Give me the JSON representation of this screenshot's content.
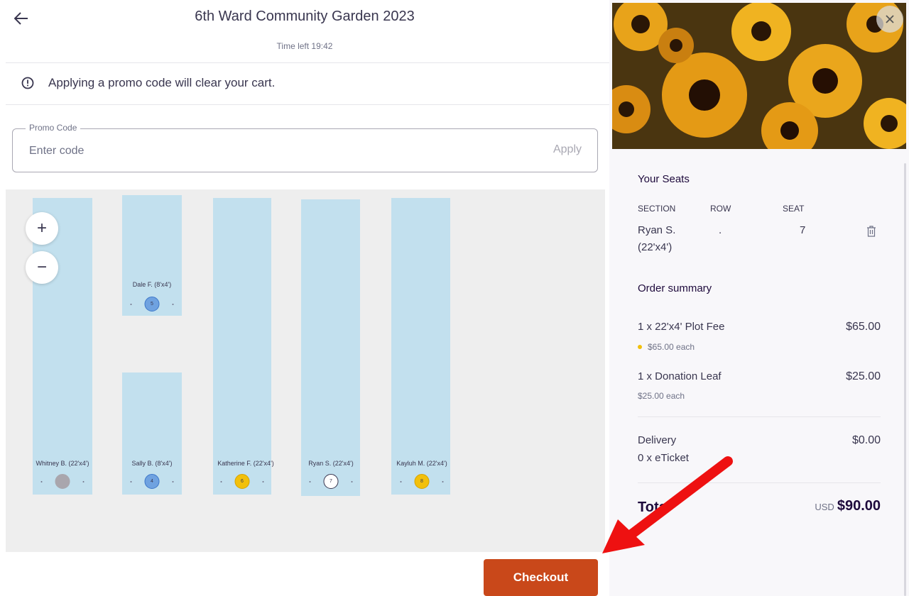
{
  "header": {
    "title": "6th Ward Community Garden 2023",
    "timer": "Time left 19:42"
  },
  "notice": {
    "text": "Applying a promo code will clear your cart."
  },
  "promo": {
    "label": "Promo Code",
    "placeholder": "Enter code",
    "apply_label": "Apply"
  },
  "map": {
    "zoom_in": "+",
    "zoom_out": "−",
    "plots": [
      {
        "label": "Dale F. (8'x4')",
        "seat": "5",
        "status": "selected-blue"
      },
      {
        "label": "Whitney B. (22'x4')",
        "seat": "",
        "status": "unavailable"
      },
      {
        "label": "Sally B. (8'x4')",
        "seat": "4",
        "status": "selected-blue"
      },
      {
        "label": "Katherine F. (22'x4')",
        "seat": "6",
        "status": "available"
      },
      {
        "label": "Ryan S. (22'x4')",
        "seat": "7",
        "status": "in-cart"
      },
      {
        "label": "Kayluh M. (22'x4')",
        "seat": "8",
        "status": "available"
      }
    ]
  },
  "checkout": {
    "label": "Checkout"
  },
  "cart": {
    "your_seats_title": "Your Seats",
    "headers": {
      "section": "SECTION",
      "row": "ROW",
      "seat": "SEAT"
    },
    "seat_item": {
      "section_line1": "Ryan S.",
      "section_line2": "(22'x4')",
      "row": ".",
      "seat": "7"
    },
    "order_summary_title": "Order summary",
    "items": [
      {
        "name": "1 x 22'x4' Plot Fee",
        "each": "$65.00 each",
        "price": "$65.00"
      },
      {
        "name": "1 x Donation Leaf",
        "each": "$25.00 each",
        "price": "$25.00"
      }
    ],
    "delivery": {
      "name": "Delivery",
      "detail": "0 x eTicket",
      "price": "$0.00"
    },
    "total": {
      "label": "Total",
      "currency": "USD",
      "amount": "$90.00"
    }
  },
  "colors": {
    "accent": "#c9481a",
    "plot": "#c2e0ee",
    "seat_yellow": "#f2c00b",
    "seat_blue": "#6fa2e0",
    "arrow": "#ee1111"
  },
  "icons": {
    "back": "arrow-left-icon",
    "info": "info-circle-icon",
    "close": "close-icon",
    "delete": "trash-icon"
  }
}
